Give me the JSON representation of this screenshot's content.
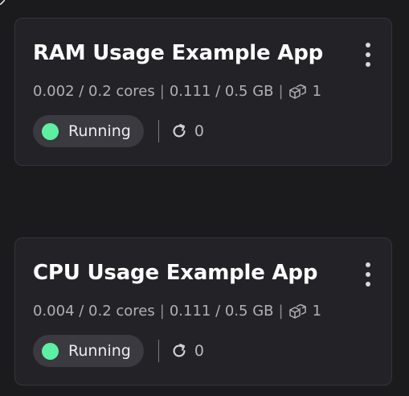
{
  "colors": {
    "background": "#1b1b1d",
    "card": "#232327",
    "status_running": "#5df0a2"
  },
  "apps": [
    {
      "title": "RAM Usage Example App",
      "cpu": "0.002 / 0.2 cores",
      "memory": "0.111 / 0.5 GB",
      "replicas": "1",
      "status": "Running",
      "restarts": "0",
      "menu_icon": "kebab-menu-icon",
      "replica_icon": "cubes-icon",
      "restart_icon": "refresh-icon"
    },
    {
      "title": "CPU Usage Example App",
      "cpu": "0.004 / 0.2 cores",
      "memory": "0.111 / 0.5 GB",
      "replicas": "1",
      "status": "Running",
      "restarts": "0",
      "menu_icon": "kebab-menu-icon",
      "replica_icon": "cubes-icon",
      "restart_icon": "refresh-icon"
    }
  ]
}
